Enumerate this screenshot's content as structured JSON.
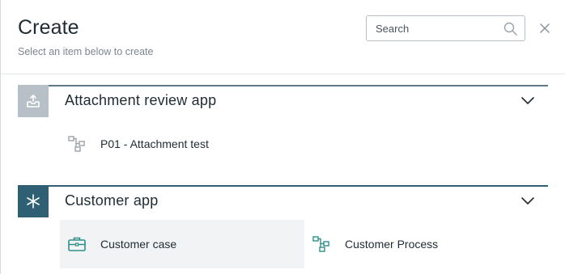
{
  "dialog": {
    "title": "Create",
    "subtitle": "Select an item below to create",
    "search": {
      "placeholder": "Search",
      "value": ""
    },
    "close_icon": "close-icon"
  },
  "colors": {
    "group1_rule": "#5f7a89",
    "group1_tile": "#b7c0c6",
    "group2_rule": "#2f5f72",
    "group2_tile": "#2f5f72",
    "item_icon_muted": "#9aa3a9",
    "item_icon_teal": "#2f8f8a",
    "hover_bg": "#f2f3f4"
  },
  "groups": [
    {
      "label": "Attachment review app",
      "icon": "inbox-upload-icon",
      "items": [
        {
          "label": "P01 - Attachment test",
          "icon": "process-flow-icon"
        }
      ]
    },
    {
      "label": "Customer app",
      "icon": "asterisk-icon",
      "items": [
        {
          "label": "Customer case",
          "icon": "briefcase-icon"
        },
        {
          "label": "Customer Process",
          "icon": "process-flow-icon"
        }
      ]
    }
  ]
}
